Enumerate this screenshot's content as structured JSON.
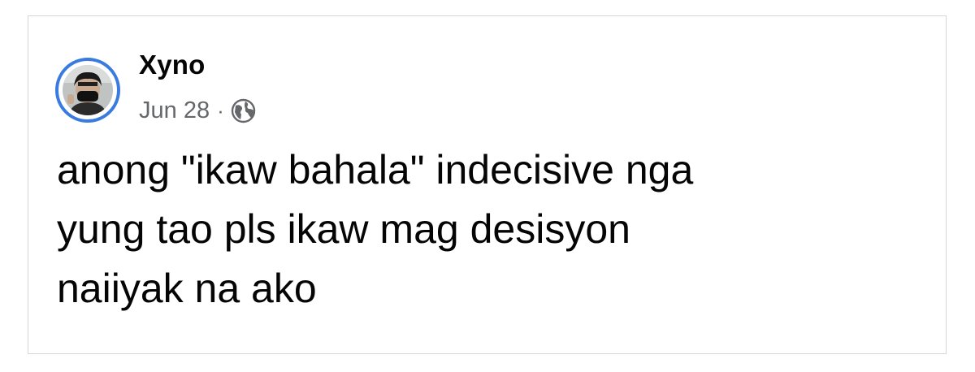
{
  "post": {
    "author": "Xyno",
    "date": "Jun 28",
    "separator": "·",
    "privacy_icon": "globe-icon",
    "text_lines": [
      "anong \"ikaw bahala\" indecisive nga",
      "yung tao pls ikaw mag desisyon",
      "naiiyak na ako"
    ]
  },
  "colors": {
    "avatar_ring": "#3a7be0",
    "name_text": "#050505",
    "meta_text": "#65676b",
    "card_border": "#d6d6d6"
  }
}
